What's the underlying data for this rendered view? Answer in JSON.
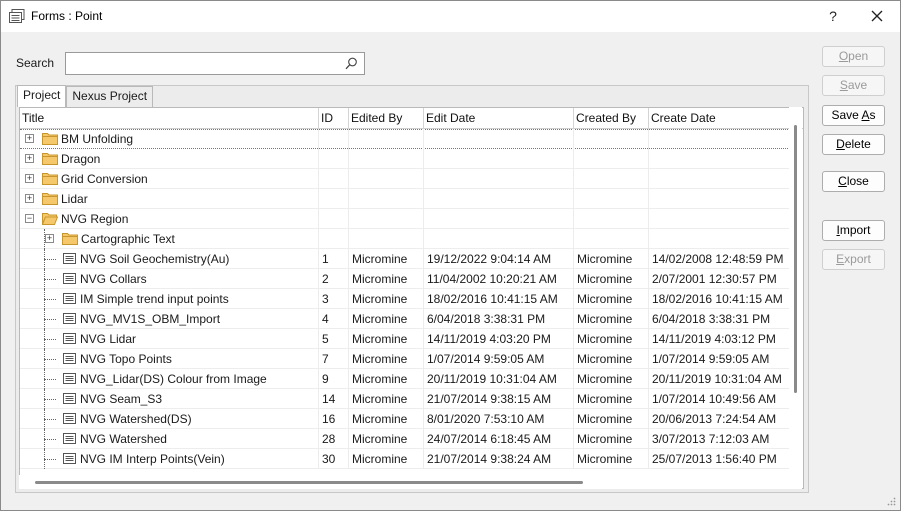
{
  "window": {
    "title": "Forms : Point",
    "help_label": "?"
  },
  "search": {
    "label": "Search",
    "value": "",
    "placeholder": ""
  },
  "tabs": [
    {
      "label": "Project",
      "active": true
    },
    {
      "label": "Nexus Project",
      "active": false
    }
  ],
  "columns": [
    "Title",
    "ID",
    "Edited By",
    "Edit Date",
    "Created By",
    "Create Date"
  ],
  "rows": [
    {
      "title": "BM Unfolding",
      "kind": "folder",
      "expander": "+",
      "level": 0,
      "focus": true,
      "id": "",
      "edited_by": "",
      "edit_date": "",
      "created_by": "",
      "create_date": ""
    },
    {
      "title": "Dragon",
      "kind": "folder",
      "expander": "+",
      "level": 0,
      "id": "",
      "edited_by": "",
      "edit_date": "",
      "created_by": "",
      "create_date": ""
    },
    {
      "title": "Grid Conversion",
      "kind": "folder",
      "expander": "+",
      "level": 0,
      "id": "",
      "edited_by": "",
      "edit_date": "",
      "created_by": "",
      "create_date": ""
    },
    {
      "title": "Lidar",
      "kind": "folder",
      "expander": "+",
      "level": 0,
      "id": "",
      "edited_by": "",
      "edit_date": "",
      "created_by": "",
      "create_date": ""
    },
    {
      "title": "NVG Region",
      "kind": "folder-open",
      "expander": "−",
      "level": 0,
      "id": "",
      "edited_by": "",
      "edit_date": "",
      "created_by": "",
      "create_date": ""
    },
    {
      "title": "Cartographic Text",
      "kind": "folder",
      "expander": "+",
      "level": 1,
      "id": "",
      "edited_by": "",
      "edit_date": "",
      "created_by": "",
      "create_date": ""
    },
    {
      "title": "NVG Soil Geochemistry(Au)",
      "kind": "form",
      "level": 1,
      "id": "1",
      "edited_by": "Micromine",
      "edit_date": "19/12/2022 9:04:14 AM",
      "created_by": "Micromine",
      "create_date": "14/02/2008 12:48:59 PM"
    },
    {
      "title": "NVG Collars",
      "kind": "form",
      "level": 1,
      "id": "2",
      "edited_by": "Micromine",
      "edit_date": "11/04/2002 10:20:21 AM",
      "created_by": "Micromine",
      "create_date": "2/07/2001 12:30:57 PM"
    },
    {
      "title": "IM Simple trend input points",
      "kind": "form",
      "level": 1,
      "id": "3",
      "edited_by": "Micromine",
      "edit_date": "18/02/2016 10:41:15 AM",
      "created_by": "Micromine",
      "create_date": "18/02/2016 10:41:15 AM"
    },
    {
      "title": "NVG_MV1S_OBM_Import",
      "kind": "form",
      "level": 1,
      "id": "4",
      "edited_by": "Micromine",
      "edit_date": "6/04/2018 3:38:31 PM",
      "created_by": "Micromine",
      "create_date": "6/04/2018 3:38:31 PM"
    },
    {
      "title": "NVG Lidar",
      "kind": "form",
      "level": 1,
      "id": "5",
      "edited_by": "Micromine",
      "edit_date": "14/11/2019 4:03:20 PM",
      "created_by": "Micromine",
      "create_date": "14/11/2019 4:03:12 PM"
    },
    {
      "title": "NVG Topo Points",
      "kind": "form",
      "level": 1,
      "id": "7",
      "edited_by": "Micromine",
      "edit_date": "1/07/2014 9:59:05 AM",
      "created_by": "Micromine",
      "create_date": "1/07/2014 9:59:05 AM"
    },
    {
      "title": "NVG_Lidar(DS) Colour from Image",
      "kind": "form",
      "level": 1,
      "id": "9",
      "edited_by": "Micromine",
      "edit_date": "20/11/2019 10:31:04 AM",
      "created_by": "Micromine",
      "create_date": "20/11/2019 10:31:04 AM"
    },
    {
      "title": "NVG Seam_S3",
      "kind": "form",
      "level": 1,
      "id": "14",
      "edited_by": "Micromine",
      "edit_date": "21/07/2014 9:38:15 AM",
      "created_by": "Micromine",
      "create_date": "1/07/2014 10:49:56 AM"
    },
    {
      "title": "NVG Watershed(DS)",
      "kind": "form",
      "level": 1,
      "id": "16",
      "edited_by": "Micromine",
      "edit_date": "8/01/2020 7:53:10 AM",
      "created_by": "Micromine",
      "create_date": "20/06/2013 7:24:54 AM"
    },
    {
      "title": "NVG Watershed",
      "kind": "form",
      "level": 1,
      "id": "28",
      "edited_by": "Micromine",
      "edit_date": "24/07/2014 6:18:45 AM",
      "created_by": "Micromine",
      "create_date": "3/07/2013 7:12:03 AM"
    },
    {
      "title": "NVG IM Interp Points(Vein)",
      "kind": "form",
      "level": 1,
      "id": "30",
      "edited_by": "Micromine",
      "edit_date": "21/07/2014 9:38:24 AM",
      "created_by": "Micromine",
      "create_date": "25/07/2013 1:56:40 PM"
    }
  ],
  "buttons": {
    "open": {
      "pre": "",
      "ul": "O",
      "post": "pen"
    },
    "save": {
      "pre": "",
      "ul": "S",
      "post": "ave"
    },
    "save_as": {
      "pre": "Save ",
      "ul": "A",
      "post": "s"
    },
    "delete": {
      "pre": "",
      "ul": "D",
      "post": "elete"
    },
    "close": {
      "pre": "",
      "ul": "C",
      "post": "lose"
    },
    "import": {
      "pre": "",
      "ul": "I",
      "post": "mport"
    },
    "export": {
      "pre": "",
      "ul": "E",
      "post": "xport"
    }
  },
  "icons": {
    "app": "forms-icon",
    "close": "close-icon",
    "search": "search-icon",
    "folder": "folder-icon",
    "form": "form-icon"
  },
  "colors": {
    "folder": "#f5c96b",
    "folder_edge": "#c9962d",
    "disabled_text": "#9a9a9a"
  }
}
